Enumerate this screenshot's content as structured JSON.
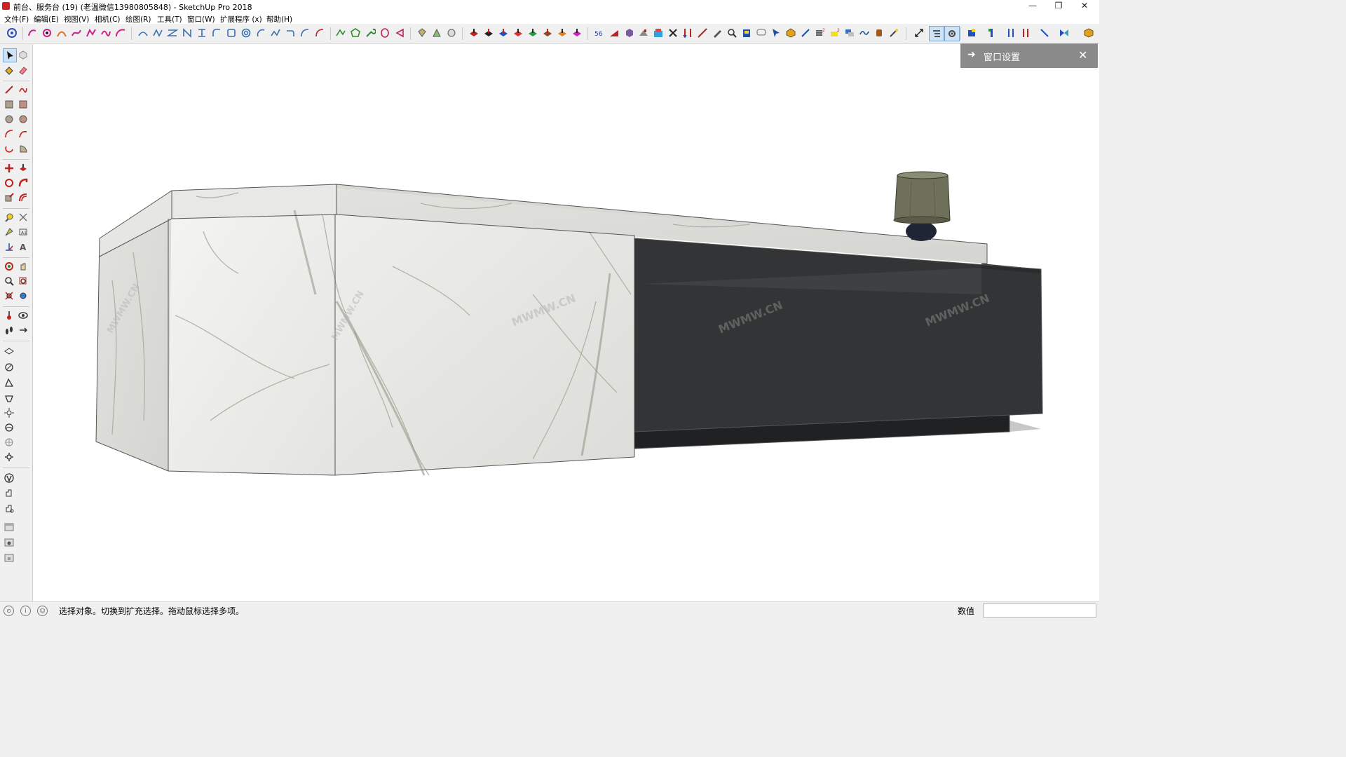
{
  "window": {
    "title": "前台、服务台 (19)  (老温微信13980805848)   - SketchUp Pro 2018",
    "minimize": "—",
    "restore": "❐",
    "close": "✕"
  },
  "menu": [
    {
      "label": "文件(F)"
    },
    {
      "label": "编辑(E)"
    },
    {
      "label": "视图(V)"
    },
    {
      "label": "相机(C)"
    },
    {
      "label": "绘图(R)"
    },
    {
      "label": "工具(T)"
    },
    {
      "label": "窗口(W)"
    },
    {
      "label": "扩展程序 (x)"
    },
    {
      "label": "帮助(H)"
    }
  ],
  "tray": {
    "title": "窗口设置",
    "arrow": "➜",
    "close": "✕"
  },
  "status": {
    "message": "选择对象。切换到扩充选择。拖动鼠标选择多项。",
    "measurements_label": "数值",
    "measurements_value": "",
    "icons": [
      "geo-location-icon",
      "info-icon",
      "user-icon"
    ]
  },
  "watermark": {
    "text": "MWMW.CN"
  },
  "colors": {
    "marble": "#e9eae7",
    "dark_panel": "#333435",
    "lamp_shade": "#6e705a",
    "tray_header": "#8a8a8a"
  }
}
